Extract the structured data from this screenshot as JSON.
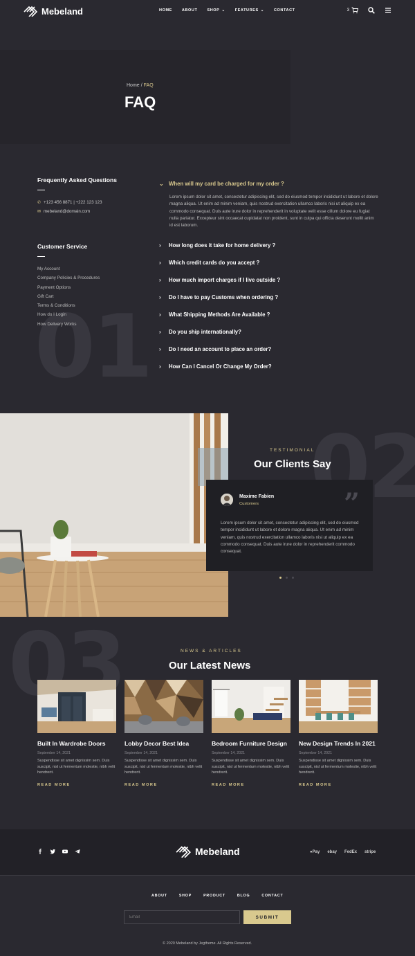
{
  "header": {
    "logo": "Mebeland",
    "nav": [
      {
        "label": "HOME",
        "has_dropdown": false
      },
      {
        "label": "ABOUT",
        "has_dropdown": false
      },
      {
        "label": "SHOP",
        "has_dropdown": true
      },
      {
        "label": "FEATURES",
        "has_dropdown": true
      },
      {
        "label": "CONTACT",
        "has_dropdown": false
      }
    ],
    "cart_count": "3"
  },
  "page_title": {
    "breadcrumb_home": "Home",
    "breadcrumb_sep": "/",
    "breadcrumb_current": "FAQ",
    "title": "FAQ"
  },
  "sidebar": {
    "faq_heading": "Frequently Asked Questions",
    "phone": "+123 456 8871 | +222 123 123",
    "email": "mebeland@domain.com",
    "cs_heading": "Customer Service",
    "links": [
      "My Account",
      "Company Policies & Procedures",
      "Payment Options",
      "Gift Cart",
      "Terms & Conditions",
      "How do I Login",
      "How Delivery Works"
    ]
  },
  "faq": {
    "active_question": "When will my card be charged for my order ?",
    "active_answer": "Lorem ipsum dolor sit amet, consectetur adipiscing elit, sed do eiusmod tempor incididunt ut labore et dolore magna aliqua. Ut enim ad minim veniam, quis nostrud exercitation ullamco laboris nisi ut aliquip ex ea commodo consequat. Duis aute irure dolor in reprehenderit in voluptate velit esse cillum dolore eu fugiat nulla pariatur. Excepteur sint occaecat cupidatat non proident, sunt in culpa qui officia deserunt mollit anim id est laborum.",
    "questions": [
      "How long does it take for home delivery ?",
      "Which credit cards do you accept ?",
      "How much import charges if I live outside ?",
      "Do I have to pay Customs when ordering ?",
      "What Shipping Methods Are Available ?",
      "Do you ship internationally?",
      "Do I need an account to place an order?",
      "How Can I Cancel Or Change My Order?"
    ]
  },
  "decor_numbers": [
    "01",
    "02",
    "03"
  ],
  "testimonial": {
    "label": "TESTIMONIAL",
    "title": "Our Clients Say",
    "name": "Maxime Fabien",
    "role": "Customers",
    "text": "Lorem ipsum dolor sit amet, consectetur adipiscing elit, sed do eiusmod tempor incididunt ut labore et dolore magna aliqua. Ut enim ad minim veniam, quis nostrud exercitation ullamco laboris nisi ut aliquip ex ea commodo consequat. Duis aute irure dolor in reprehenderit commodo consequat."
  },
  "news": {
    "label": "NEWS & ARTICLES",
    "title": "Our Latest News",
    "read_more": "READ MORE",
    "articles": [
      {
        "title": "Built In Wardrobe Doors",
        "date": "September 14, 2021",
        "excerpt": "Suspendisse sit amet dignissim sem. Duis suscipit, nisl ut fermentum molestie, nibh velit hendrerit."
      },
      {
        "title": "Lobby Decor Best Idea",
        "date": "September 14, 2021",
        "excerpt": "Suspendisse sit amet dignissim sem. Duis suscipit, nisl ut fermentum molestie, nibh velit hendrerit."
      },
      {
        "title": "Bedroom Furniture Design",
        "date": "September 14, 2021",
        "excerpt": "Suspendisse sit amet dignissim sem. Duis suscipit, nisl ut fermentum molestie, nibh velit hendrerit."
      },
      {
        "title": "New Design Trends In 2021",
        "date": "September 14, 2021",
        "excerpt": "Suspendisse sit amet dignissim sem. Duis suscipit, nisl ut fermentum molestie, nibh velit hendrerit."
      }
    ]
  },
  "footer": {
    "logo": "Mebeland",
    "payments": [
      "Pay",
      "ebay",
      "FedEx",
      "stripe"
    ],
    "nav": [
      "ABOUT",
      "SHOP",
      "PRODUCT",
      "BLOG",
      "CONTACT"
    ],
    "email_placeholder": "Email",
    "submit": "SUBMIT",
    "copyright": "© 2020 Mebeland by Jegtheme. All Rights Reserved."
  },
  "colors": {
    "background": "#2a2930",
    "accent": "#d9c98e",
    "card": "#1f1f24"
  },
  "icons": [
    "logo-mark-icon",
    "cart-icon",
    "search-icon",
    "menu-icon",
    "phone-icon",
    "mail-icon",
    "chevron-right-icon",
    "chevron-down-icon",
    "quote-icon",
    "facebook-icon",
    "twitter-icon",
    "youtube-icon",
    "telegram-icon",
    "apple-pay-icon"
  ]
}
